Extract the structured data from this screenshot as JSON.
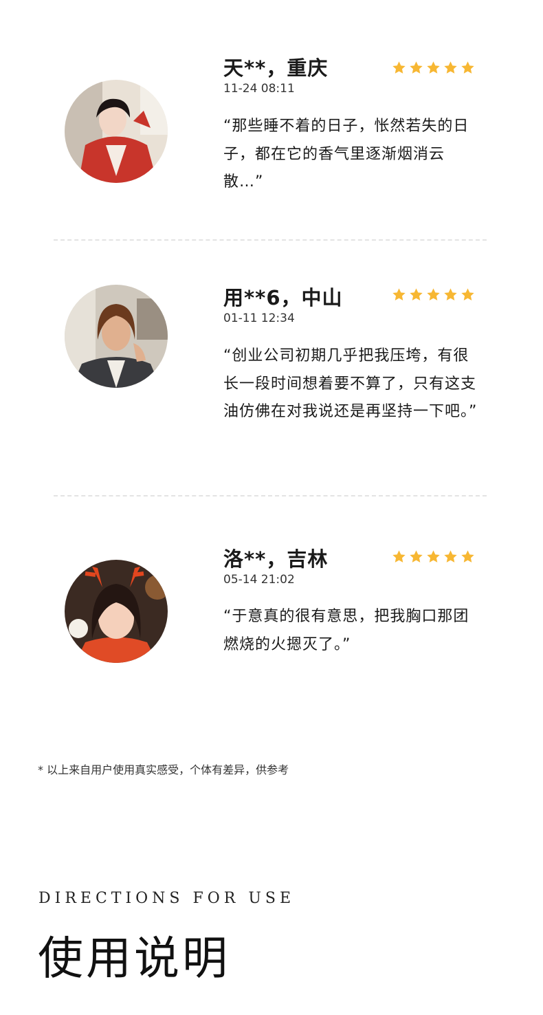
{
  "reviews": [
    {
      "name": "天**，重庆",
      "time": "11-24 08:11",
      "rating": 5,
      "quote": "“那些睡不着的日子，怅然若失的日子，都在它的香气里逐渐烟消云散…”"
    },
    {
      "name": "用**6，中山",
      "time": "01-11 12:34",
      "rating": 5,
      "quote": "“创业公司初期几乎把我压垮，有很长一段时间想着要不算了，只有这支油仿佛在对我说还是再坚持一下吧。”"
    },
    {
      "name": "洛**，吉林",
      "time": "05-14 21:02",
      "rating": 5,
      "quote": "“于意真的很有意思，把我胸口那团燃烧的火摁灭了。”"
    }
  ],
  "footnote": "* 以上来自用户使用真实感受，个体有差异，供参考",
  "directions": {
    "title_en": "DIRECTIONS FOR USE",
    "title_cn": "使用说明"
  },
  "colors": {
    "star": "#f7b733",
    "divider": "#e3e3e3"
  }
}
